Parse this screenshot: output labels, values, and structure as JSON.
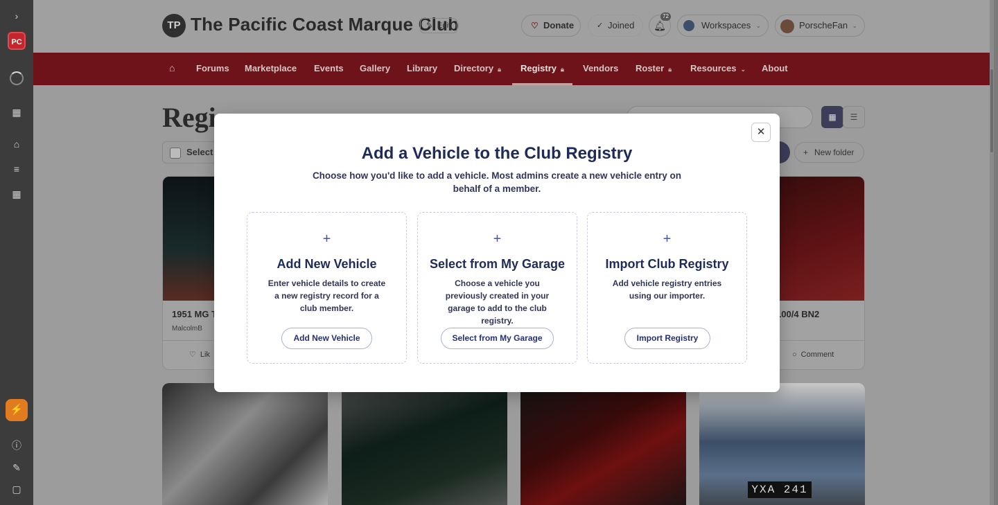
{
  "app": {
    "rail_logo": "PC"
  },
  "header": {
    "club_initials": "TP",
    "club_name": "The Pacific Coast Marque Club",
    "edit_label": "Edit",
    "donate_label": "Donate",
    "joined_label": "Joined",
    "notifications_count": "72",
    "workspaces_label": "Workspaces",
    "user_name": "PorscheFan"
  },
  "nav": {
    "items": [
      {
        "label": "Forums"
      },
      {
        "label": "Marketplace"
      },
      {
        "label": "Events"
      },
      {
        "label": "Gallery"
      },
      {
        "label": "Library"
      },
      {
        "label": "Directory"
      },
      {
        "label": "Registry"
      },
      {
        "label": "Vendors"
      },
      {
        "label": "Roster"
      },
      {
        "label": "Resources"
      },
      {
        "label": "About"
      }
    ],
    "active": "Registry"
  },
  "page": {
    "heading": "Regi",
    "select_label": "Select",
    "new_folder_label": "New folder"
  },
  "cards": [
    {
      "title": "1951 MG T",
      "owner": "MalcolmB",
      "action": "Lik"
    },
    {
      "title": "ey 100/4 BN2",
      "action": "Comment"
    }
  ],
  "photo_plate": "YXA 241",
  "modal": {
    "title": "Add a Vehicle to the Club Registry",
    "subtitle": "Choose how you'd like to add a vehicle. Most admins create a new vehicle entry on behalf of a member.",
    "options": [
      {
        "heading": "Add New Vehicle",
        "description": "Enter vehicle details to create a new registry record for a club member.",
        "button": "Add New Vehicle"
      },
      {
        "heading": "Select from My Garage",
        "description": "Choose a vehicle you previously created in your garage to add to the club registry.",
        "button": "Select from My Garage"
      },
      {
        "heading": "Import Club Registry",
        "description": "Add vehicle registry entries using our importer.",
        "button": "Import Registry"
      }
    ]
  },
  "colors": {
    "nav_bg": "#6d1319",
    "modal_heading": "#1e2a5a",
    "accent": "#4a55a0",
    "rail_logo": "#c1272d"
  }
}
